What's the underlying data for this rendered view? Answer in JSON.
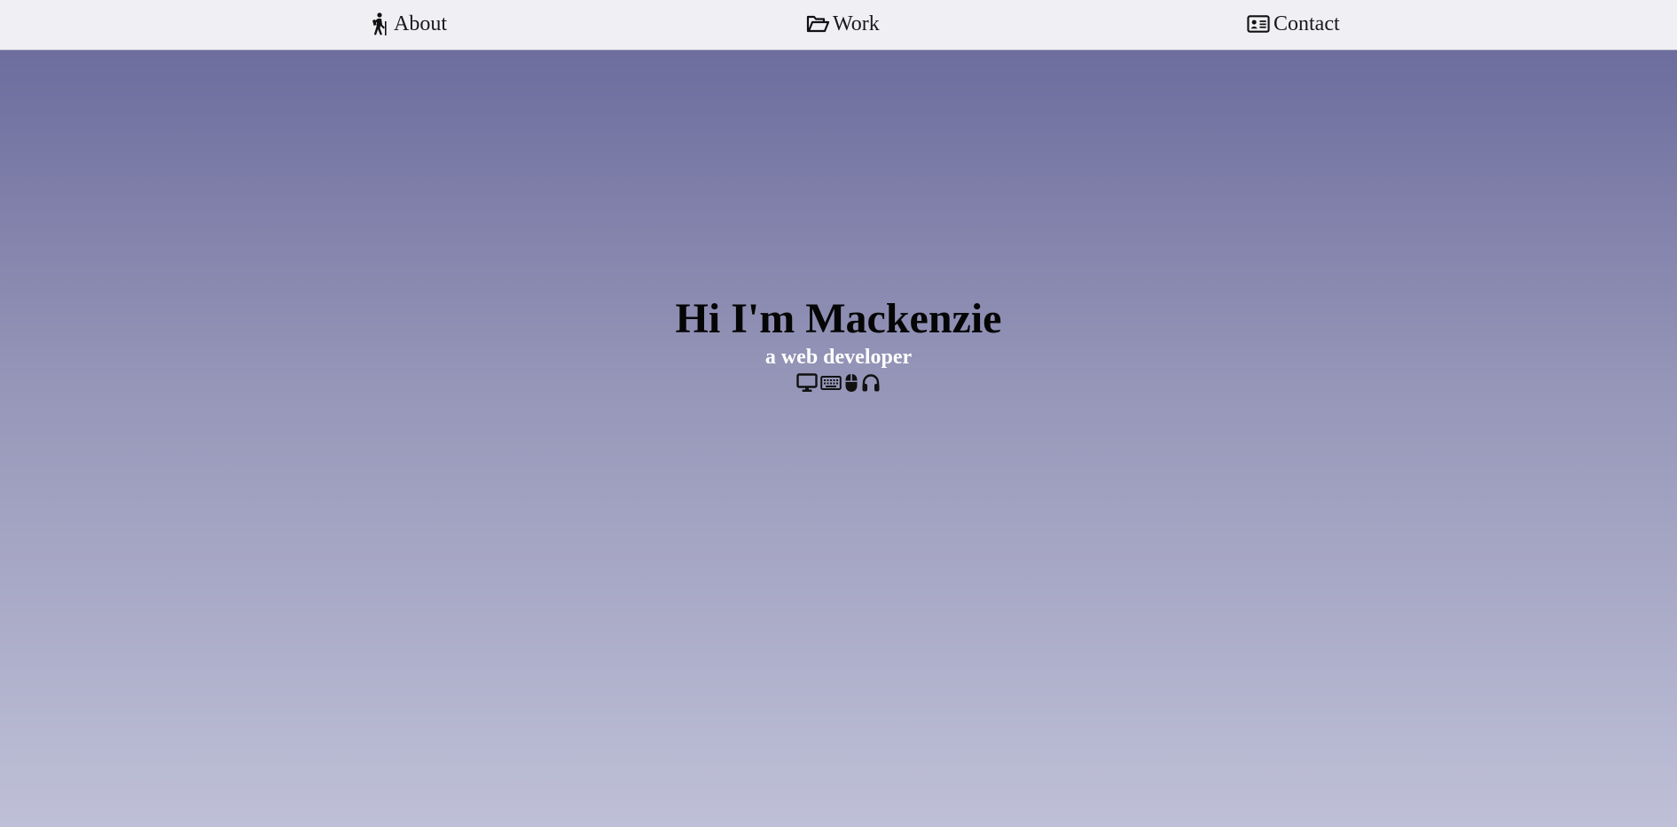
{
  "nav": {
    "items": [
      {
        "label": "About",
        "icon": "hiking-person-icon"
      },
      {
        "label": "Work",
        "icon": "open-folder-icon"
      },
      {
        "label": "Contact",
        "icon": "contact-card-icon"
      }
    ]
  },
  "hero": {
    "title": "Hi I'm Mackenzie",
    "subtitle": "a web developer",
    "icons": [
      "desktop-icon",
      "keyboard-icon",
      "mouse-icon",
      "headphones-icon"
    ]
  },
  "colors": {
    "nav_background": "#f0eff4",
    "hero_gradient_top": "#6d6d9e",
    "hero_gradient_bottom": "#bfc0d7",
    "subtitle": "#ffffff"
  }
}
